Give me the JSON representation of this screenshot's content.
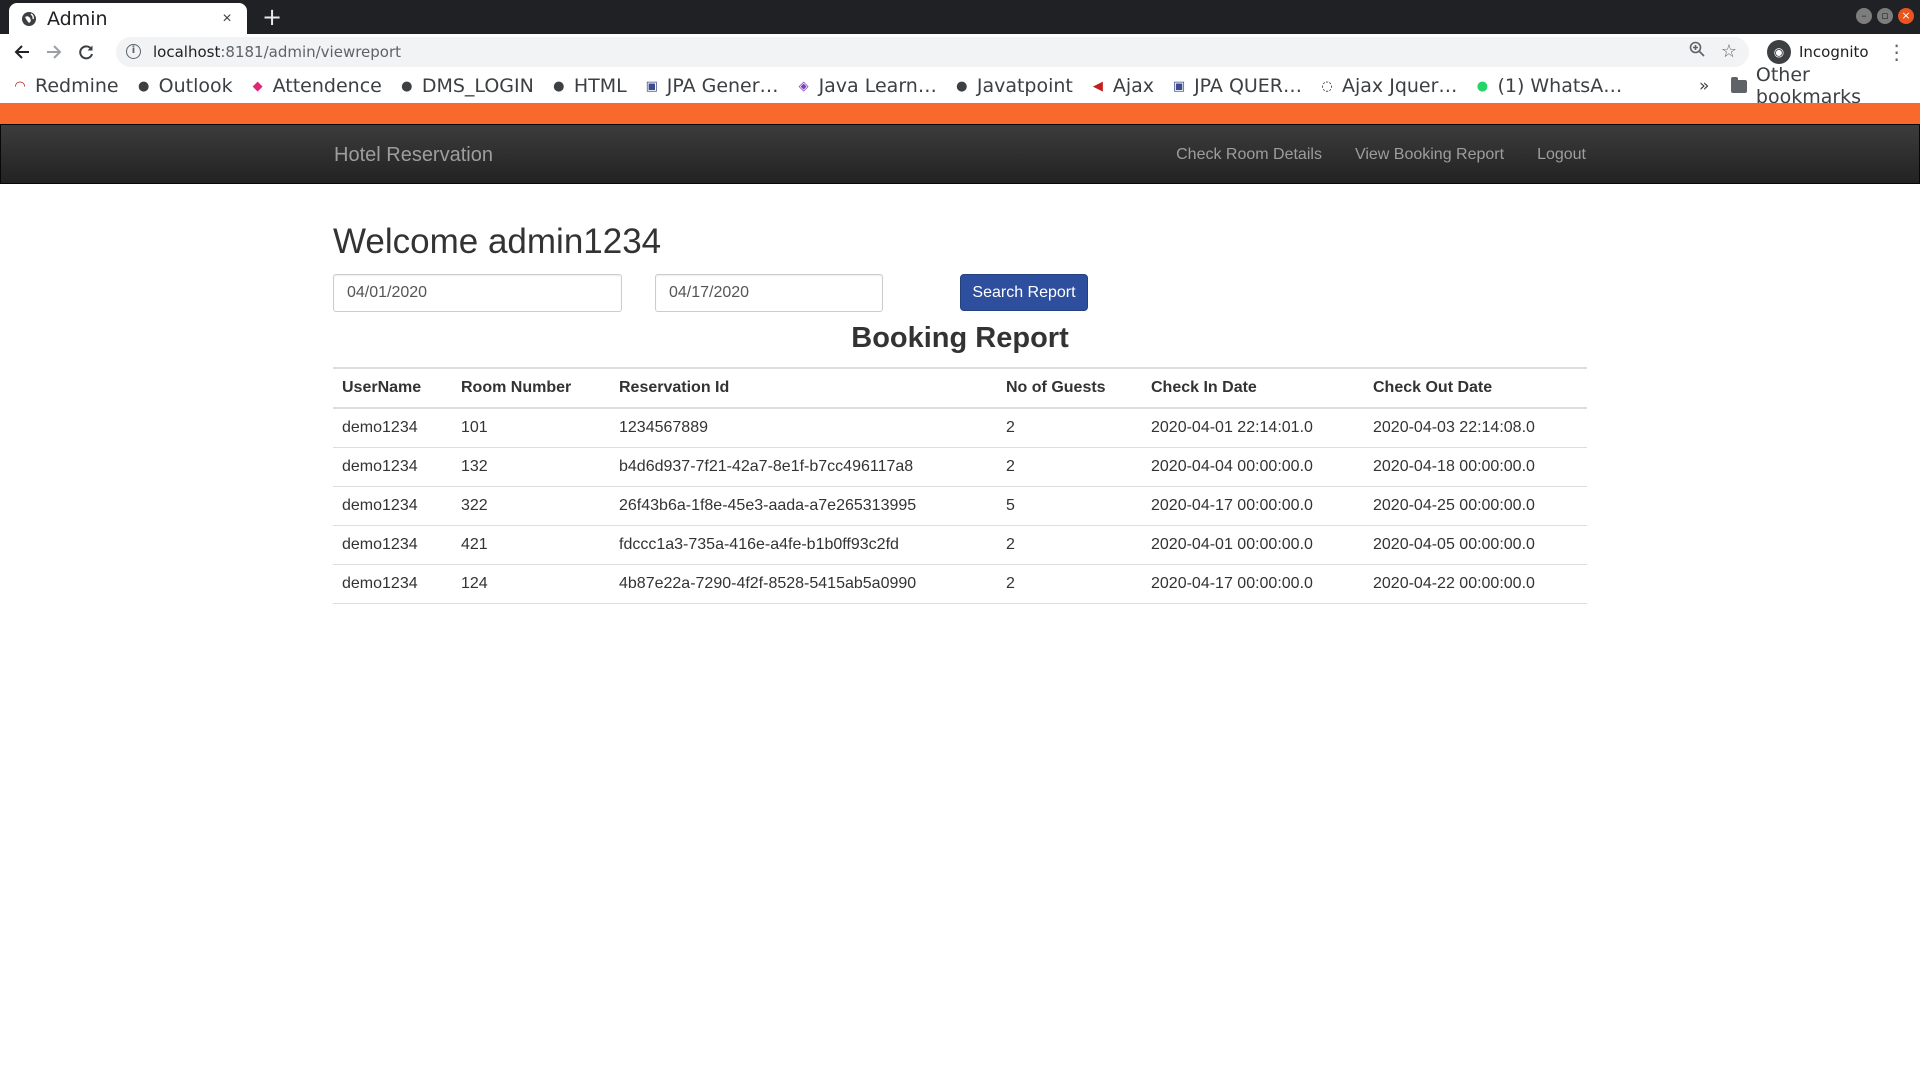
{
  "browser": {
    "tab_title": "Admin",
    "tab_close": "×",
    "new_tab": "+",
    "url_host": "localhost",
    "url_path": ":8181/admin/viewreport",
    "incognito_label": "Incognito",
    "bookmarks": [
      {
        "label": "Redmine",
        "icon": "redmine-icon",
        "color": "#b32024"
      },
      {
        "label": "Outlook",
        "icon": "globe-icon",
        "color": "#3c4043"
      },
      {
        "label": "Attendence",
        "icon": "attendence-icon",
        "color": "#e0257a"
      },
      {
        "label": "DMS_LOGIN",
        "icon": "globe-icon",
        "color": "#3c4043"
      },
      {
        "label": "HTML",
        "icon": "globe-icon",
        "color": "#3c4043"
      },
      {
        "label": "JPA Gener…",
        "icon": "doc-icon",
        "color": "#3b4b8f"
      },
      {
        "label": "Java Learn…",
        "icon": "java-icon",
        "color": "#7a3fbd"
      },
      {
        "label": "Javatpoint",
        "icon": "globe-icon",
        "color": "#3c4043"
      },
      {
        "label": "Ajax",
        "icon": "ajax-icon",
        "color": "#c41e1e"
      },
      {
        "label": "JPA QUER…",
        "icon": "doc-icon",
        "color": "#3b4b8f"
      },
      {
        "label": "Ajax Jquer…",
        "icon": "spinner-icon",
        "color": "#222222"
      },
      {
        "label": "(1) WhatsA…",
        "icon": "whatsapp-icon",
        "color": "#25d366"
      }
    ],
    "bookmarks_more": "»",
    "other_bookmarks": "Other bookmarks"
  },
  "theme": {
    "accent_bar": "#f9692b",
    "navbar_bg": "#222222",
    "button_primary": "#2e4e9e"
  },
  "navbar": {
    "brand": "Hotel Reservation",
    "links": [
      "Check Room Details",
      "View Booking Report",
      "Logout"
    ]
  },
  "main": {
    "welcome": "Welcome admin1234",
    "date_from": "04/01/2020",
    "date_to": "04/17/2020",
    "search_button": "Search Report",
    "report_title": "Booking Report"
  },
  "table": {
    "headers": [
      "UserName",
      "Room Number",
      "Reservation Id",
      "No of Guests",
      "Check In Date",
      "Check Out Date"
    ],
    "rows": [
      [
        "demo1234",
        "101",
        "1234567889",
        "2",
        "2020-04-01 22:14:01.0",
        "2020-04-03 22:14:08.0"
      ],
      [
        "demo1234",
        "132",
        "b4d6d937-7f21-42a7-8e1f-b7cc496117a8",
        "2",
        "2020-04-04 00:00:00.0",
        "2020-04-18 00:00:00.0"
      ],
      [
        "demo1234",
        "322",
        "26f43b6a-1f8e-45e3-aada-a7e265313995",
        "5",
        "2020-04-17 00:00:00.0",
        "2020-04-25 00:00:00.0"
      ],
      [
        "demo1234",
        "421",
        "fdccc1a3-735a-416e-a4fe-b1b0ff93c2fd",
        "2",
        "2020-04-01 00:00:00.0",
        "2020-04-05 00:00:00.0"
      ],
      [
        "demo1234",
        "124",
        "4b87e22a-7290-4f2f-8528-5415ab5a0990",
        "2",
        "2020-04-17 00:00:00.0",
        "2020-04-22 00:00:00.0"
      ]
    ]
  }
}
